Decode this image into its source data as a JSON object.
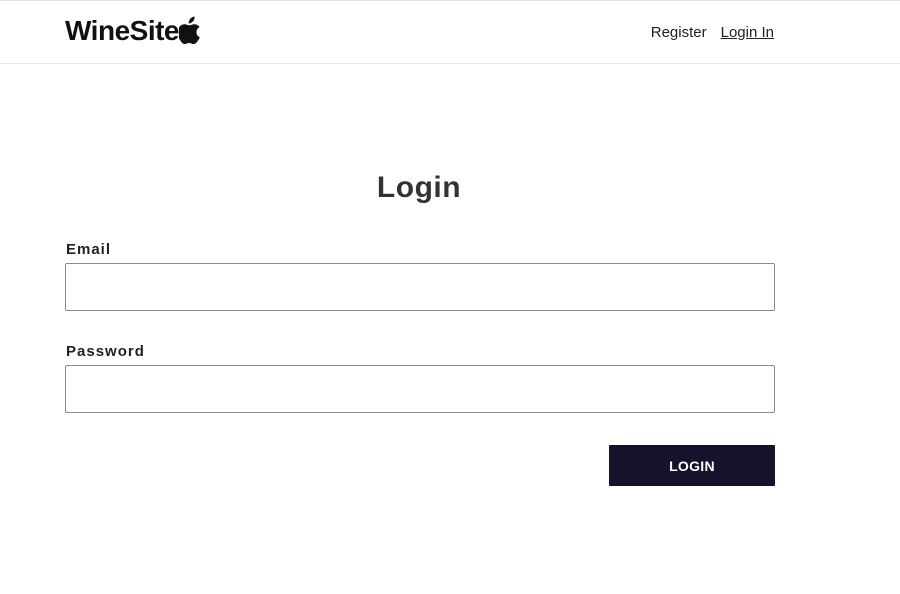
{
  "header": {
    "brand": "WineSite",
    "logo_icon": "apple-icon",
    "nav": {
      "register": "Register",
      "login": "Login In"
    }
  },
  "form": {
    "title": "Login",
    "email_label": "Email",
    "email_value": "",
    "password_label": "Password",
    "password_value": "",
    "submit_label": "LOGIN"
  },
  "colors": {
    "button_bg": "#15132b",
    "button_text": "#ffffff",
    "input_border": "#8a8a8a"
  }
}
